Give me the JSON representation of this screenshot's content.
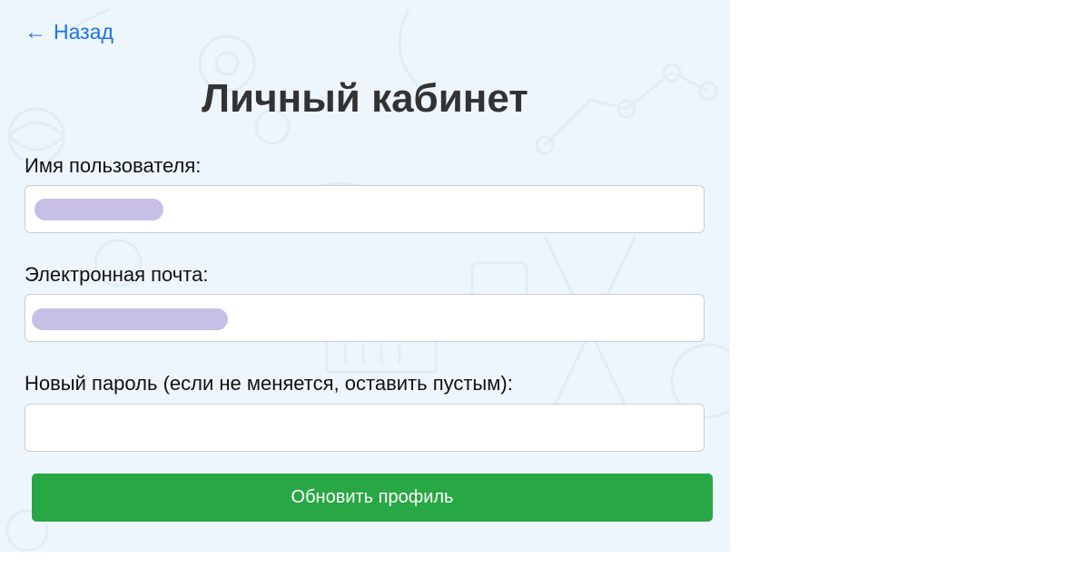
{
  "nav": {
    "back_label": "Назад",
    "back_icon": "left-arrow-icon"
  },
  "page": {
    "title": "Личный кабинет"
  },
  "form": {
    "username": {
      "label": "Имя пользователя:",
      "value": ""
    },
    "email": {
      "label": "Электронная почта:",
      "value": ""
    },
    "new_password": {
      "label": "Новый пароль (если не меняется, оставить пустым):",
      "value": ""
    },
    "submit_label": "Обновить профиль"
  },
  "colors": {
    "link": "#1a73e8",
    "submit": "#28a745",
    "panel_bg": "#eef6fd",
    "redaction": "#c7bfe6"
  }
}
